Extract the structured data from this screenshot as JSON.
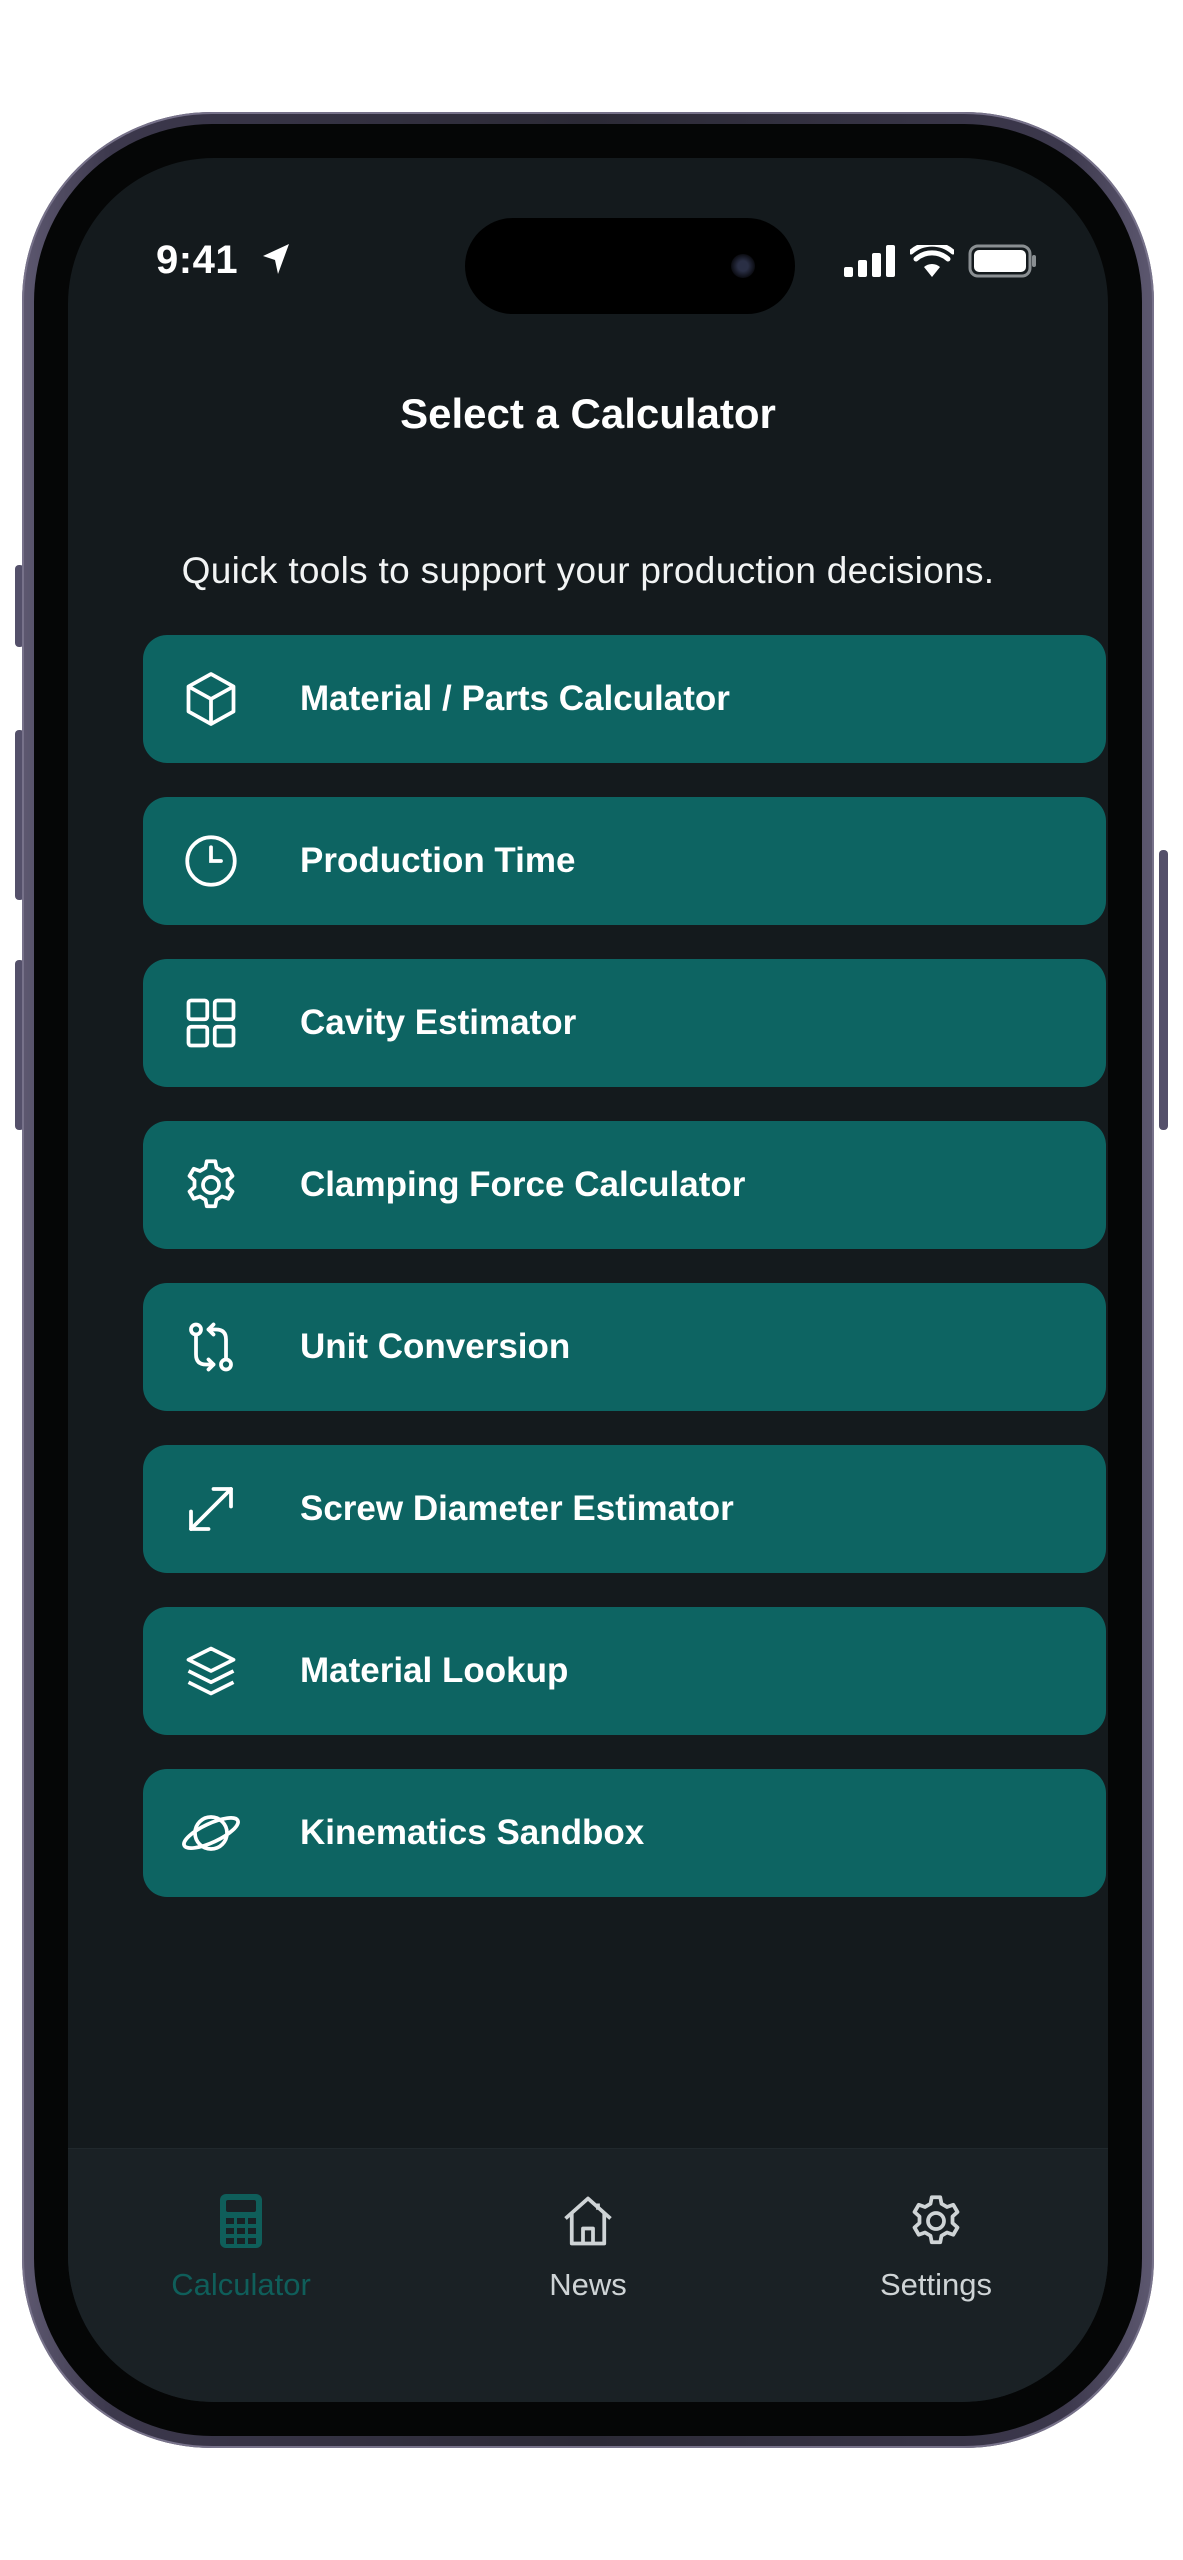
{
  "status_bar": {
    "time": "9:41",
    "location_icon": "location-arrow-icon",
    "signal_icon": "cellular-signal-icon",
    "wifi_icon": "wifi-icon",
    "battery_icon": "battery-icon"
  },
  "header": {
    "title": "Select a Calculator",
    "subtitle": "Quick tools to support your production decisions."
  },
  "menu": {
    "items": [
      {
        "label": "Material / Parts Calculator",
        "icon": "cube-icon"
      },
      {
        "label": "Production Time",
        "icon": "clock-icon"
      },
      {
        "label": "Cavity Estimator",
        "icon": "grid-icon"
      },
      {
        "label": "Clamping Force Calculator",
        "icon": "gear-icon"
      },
      {
        "label": "Unit Conversion",
        "icon": "swap-arrows-icon"
      },
      {
        "label": "Screw Diameter Estimator",
        "icon": "expand-diagonal-icon"
      },
      {
        "label": "Material Lookup",
        "icon": "layers-icon"
      },
      {
        "label": "Kinematics Sandbox",
        "icon": "planet-icon"
      }
    ]
  },
  "tab_bar": {
    "tabs": [
      {
        "label": "Calculator",
        "icon": "calculator-icon",
        "active": true
      },
      {
        "label": "News",
        "icon": "home-icon",
        "active": false
      },
      {
        "label": "Settings",
        "icon": "gear-icon",
        "active": false
      }
    ]
  },
  "colors": {
    "screen_background": "#141a1d",
    "menu_item_background": "#0d6462",
    "tab_bar_background": "#1a2125",
    "active_tab": "#0f5e5a",
    "inactive_tab": "#cfd4d6"
  }
}
